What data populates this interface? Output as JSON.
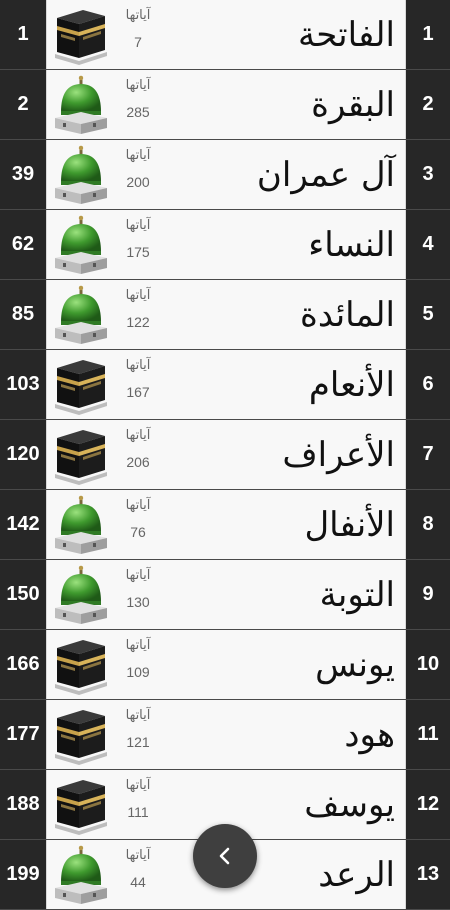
{
  "surahs": [
    {
      "page": "1",
      "number": "1",
      "name": "الفاتحة",
      "ayat_label": "آياتها",
      "ayat": "7",
      "icon": "kaaba-icon"
    },
    {
      "page": "2",
      "number": "2",
      "name": "البقرة",
      "ayat_label": "آياتها",
      "ayat": "285",
      "icon": "green-dome-icon"
    },
    {
      "page": "39",
      "number": "3",
      "name": "آل عمران",
      "ayat_label": "آياتها",
      "ayat": "200",
      "icon": "green-dome-icon"
    },
    {
      "page": "62",
      "number": "4",
      "name": "النساء",
      "ayat_label": "آياتها",
      "ayat": "175",
      "icon": "green-dome-icon"
    },
    {
      "page": "85",
      "number": "5",
      "name": "المائدة",
      "ayat_label": "آياتها",
      "ayat": "122",
      "icon": "green-dome-icon"
    },
    {
      "page": "103",
      "number": "6",
      "name": "الأنعام",
      "ayat_label": "آياتها",
      "ayat": "167",
      "icon": "kaaba-icon"
    },
    {
      "page": "120",
      "number": "7",
      "name": "الأعراف",
      "ayat_label": "آياتها",
      "ayat": "206",
      "icon": "kaaba-icon"
    },
    {
      "page": "142",
      "number": "8",
      "name": "الأنفال",
      "ayat_label": "آياتها",
      "ayat": "76",
      "icon": "green-dome-icon"
    },
    {
      "page": "150",
      "number": "9",
      "name": "التوبة",
      "ayat_label": "آياتها",
      "ayat": "130",
      "icon": "green-dome-icon"
    },
    {
      "page": "166",
      "number": "10",
      "name": "يونس",
      "ayat_label": "آياتها",
      "ayat": "109",
      "icon": "kaaba-icon"
    },
    {
      "page": "177",
      "number": "11",
      "name": "هود",
      "ayat_label": "آياتها",
      "ayat": "121",
      "icon": "kaaba-icon"
    },
    {
      "page": "188",
      "number": "12",
      "name": "يوسف",
      "ayat_label": "آياتها",
      "ayat": "111",
      "icon": "kaaba-icon"
    },
    {
      "page": "199",
      "number": "13",
      "name": "الرعد",
      "ayat_label": "آياتها",
      "ayat": "44",
      "icon": "green-dome-icon"
    }
  ],
  "back_button": {
    "icon": "chevron-left-icon"
  },
  "colors": {
    "side_columns": "#272727",
    "card": "#f8f8f8",
    "dome": "#3f9a2e",
    "back_button": "#3f3f3f"
  }
}
